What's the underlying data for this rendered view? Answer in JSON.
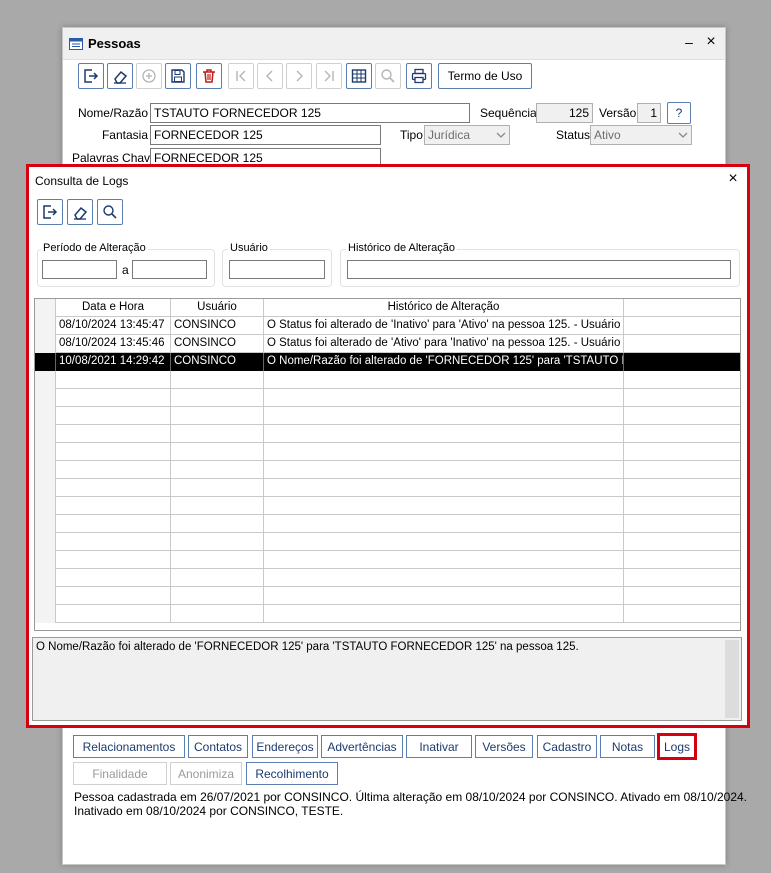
{
  "window": {
    "title": "Pessoas",
    "minimize": "–",
    "close": "×"
  },
  "toolbar": {
    "termo_label": "Termo de Uso"
  },
  "form": {
    "nome_label": "Nome/Razão",
    "nome_value": "TSTAUTO FORNECEDOR 125",
    "sequencia_label": "Sequência",
    "sequencia_value": "125",
    "versao_label": "Versão",
    "versao_value": "1",
    "help_label": "?",
    "fantasia_label": "Fantasia",
    "fantasia_value": "FORNECEDOR 125",
    "tipo_label": "Tipo",
    "tipo_value": "Jurídica",
    "status_label": "Status",
    "status_value": "Ativo",
    "palavras_label": "Palavras Chave",
    "palavras_value": "FORNECEDOR 125"
  },
  "dialog": {
    "title": "Consulta de Logs",
    "close": "×",
    "periodo_label": "Período de Alteração",
    "periodo_sep": "a",
    "usuario_label": "Usuário",
    "historico_label": "Histórico de Alteração",
    "grid": {
      "headers": [
        "Data e Hora",
        "Usuário",
        "Histórico de Alteração",
        ""
      ],
      "rows": [
        {
          "data": "08/10/2024 13:45:47",
          "usuario": "CONSINCO",
          "historico": "O Status foi alterado de 'Inativo' para 'Ativo' na pessoa 125. - Usuário S.O.:"
        },
        {
          "data": "08/10/2024 13:45:46",
          "usuario": "CONSINCO",
          "historico": "O Status foi alterado de 'Ativo' para 'Inativo' na pessoa 125. - Usuário S.O.:"
        },
        {
          "data": "10/08/2021 14:29:42",
          "usuario": "CONSINCO",
          "historico": "O Nome/Razão foi alterado de 'FORNECEDOR 125' para 'TSTAUTO FOR"
        }
      ],
      "selected_row": 2,
      "total_visible_rows": 17
    },
    "detail_text": "O Nome/Razão foi alterado de 'FORNECEDOR 125' para 'TSTAUTO FORNECEDOR 125' na pessoa 125."
  },
  "tabs_row1": [
    "Relacionamentos",
    "Contatos",
    "Endereços",
    "Advertências",
    "Inativar",
    "Versões",
    "Cadastro",
    "Notas",
    "Logs"
  ],
  "tabs_row2": [
    "Finalidade",
    "Anonimiza",
    "Recolhimento"
  ],
  "status": {
    "line1": "Pessoa cadastrada em 26/07/2021 por CONSINCO. Última alteração em 08/10/2024 por CONSINCO. Ativado em 08/10/2024.",
    "line2": "Inativado em 08/10/2024 por CONSINCO, TESTE."
  },
  "colors": {
    "highlight": "#d7000f",
    "button_border": "#5a7fb0",
    "selected_row": "#000000"
  }
}
